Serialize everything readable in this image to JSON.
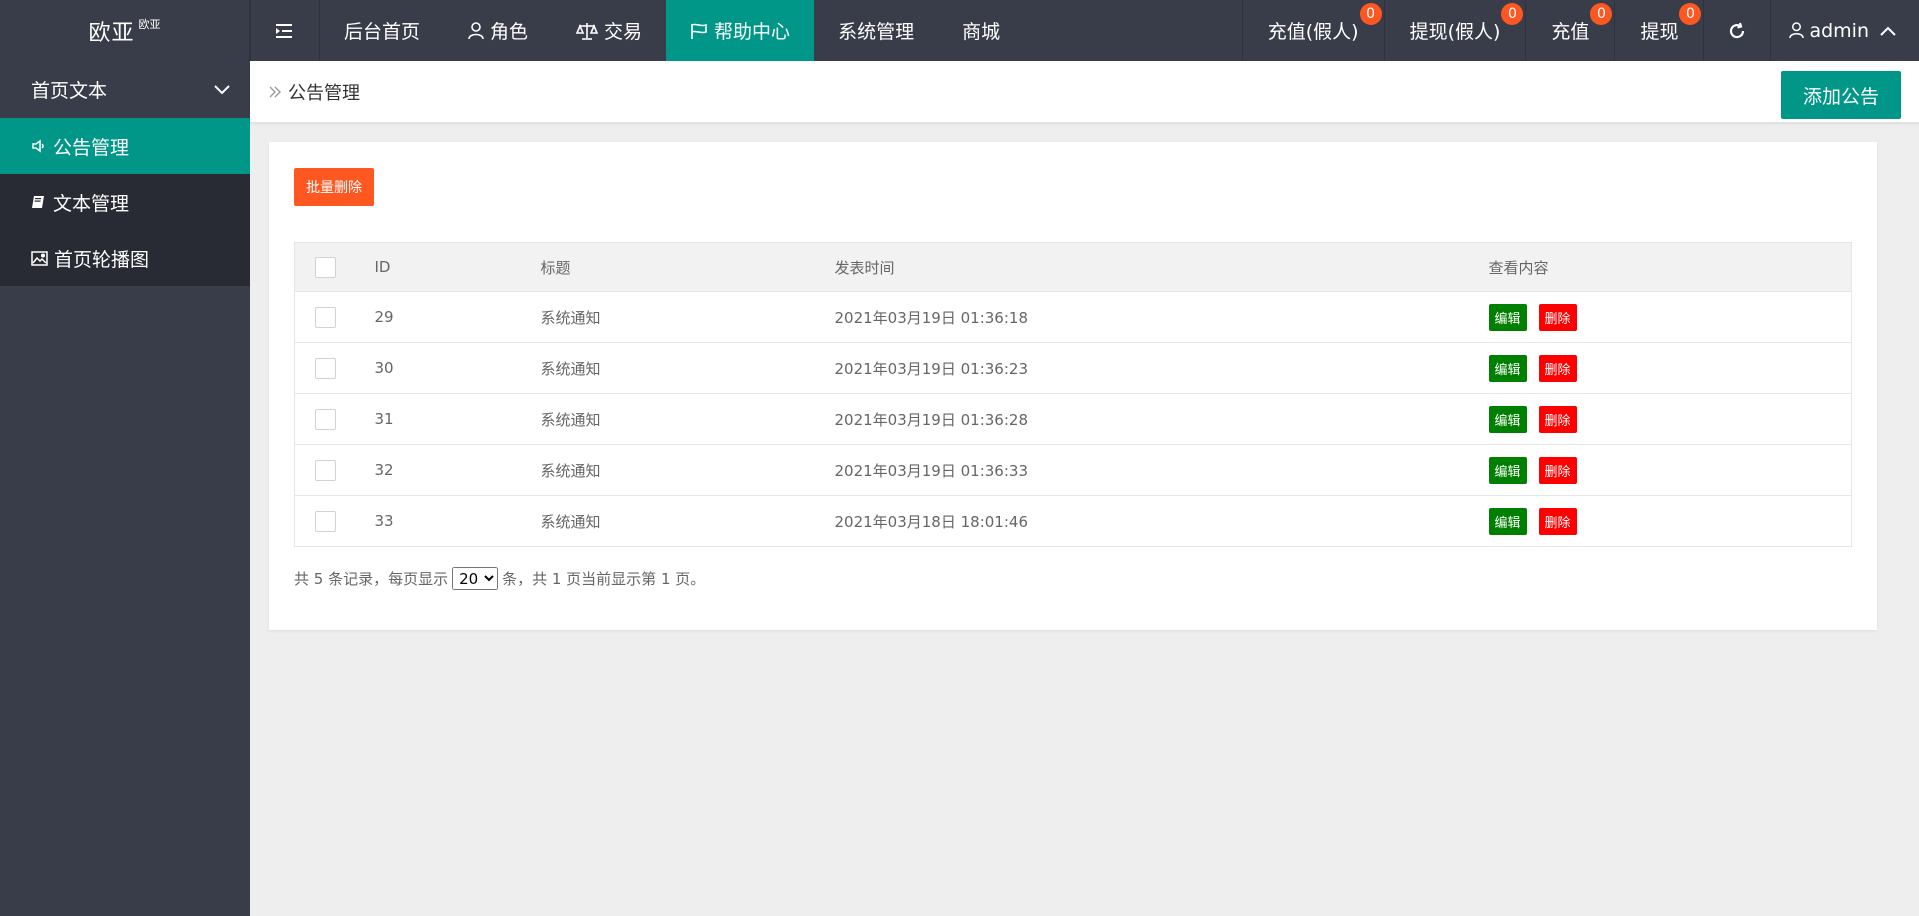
{
  "brand": {
    "name": "欧亚",
    "sup": "欧亚"
  },
  "nav": {
    "items": [
      {
        "label": "后台首页",
        "icon": "none"
      },
      {
        "label": "角色",
        "icon": "user-icon"
      },
      {
        "label": "交易",
        "icon": "scale-icon"
      },
      {
        "label": "帮助中心",
        "icon": "flag-icon",
        "active": true
      },
      {
        "label": "系统管理",
        "icon": "none"
      },
      {
        "label": "商城",
        "icon": "none"
      }
    ],
    "right": [
      {
        "label": "充值(假人)",
        "badge": "0"
      },
      {
        "label": "提现(假人)",
        "badge": "0"
      },
      {
        "label": "充值",
        "badge": "0"
      },
      {
        "label": "提现",
        "badge": "0"
      }
    ],
    "user": "admin"
  },
  "sidebar": {
    "group": "首页文本",
    "items": [
      {
        "label": "公告管理",
        "icon": "speaker-icon",
        "active": true
      },
      {
        "label": "文本管理",
        "icon": "book-icon"
      },
      {
        "label": "首页轮播图",
        "icon": "image-icon"
      }
    ]
  },
  "breadcrumb": "公告管理",
  "add_button": "添加公告",
  "batch_delete": "批量删除",
  "table": {
    "headers": {
      "id": "ID",
      "title": "标题",
      "time": "发表时间",
      "view": "查看内容"
    },
    "rows": [
      {
        "id": "29",
        "title": "系统通知",
        "time": "2021年03月19日 01:36:18"
      },
      {
        "id": "30",
        "title": "系统通知",
        "time": "2021年03月19日 01:36:23"
      },
      {
        "id": "31",
        "title": "系统通知",
        "time": "2021年03月19日 01:36:28"
      },
      {
        "id": "32",
        "title": "系统通知",
        "time": "2021年03月19日 01:36:33"
      },
      {
        "id": "33",
        "title": "系统通知",
        "time": "2021年03月18日 18:01:46"
      }
    ],
    "edit_label": "编辑",
    "delete_label": "删除"
  },
  "pager": {
    "prefix": "共 5 条记录，每页显示",
    "per_page": "20",
    "suffix": "条，共 1 页当前显示第 1 页。"
  },
  "colors": {
    "header": "#393d49",
    "accent": "#009688",
    "batch": "#ff5722",
    "edit": "#008000",
    "delete": "#ff0000"
  }
}
